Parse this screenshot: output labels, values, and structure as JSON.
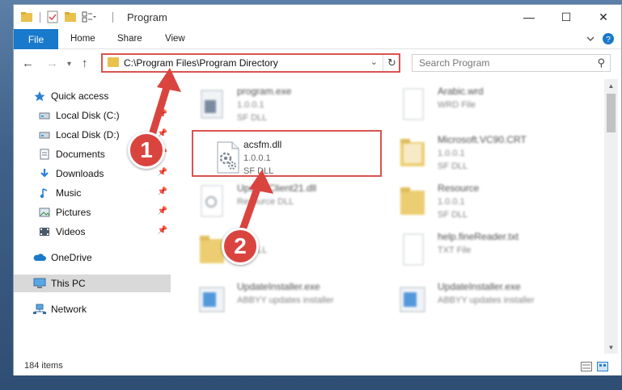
{
  "window": {
    "title": "Program",
    "controls": {
      "minimize": "—",
      "maximize": "☐",
      "close": "✕"
    }
  },
  "ribbon": {
    "tabs": [
      "File",
      "Home",
      "Share",
      "View"
    ]
  },
  "navigation": {
    "address": "C:\\Program Files\\Program Directory",
    "search_placeholder": "Search Program"
  },
  "sidebar": {
    "items": [
      {
        "label": "Quick access",
        "icon": "star-icon"
      },
      {
        "label": "Local Disk (C:)",
        "icon": "drive-icon",
        "pinned": true
      },
      {
        "label": "Local Disk (D:)",
        "icon": "drive-icon",
        "pinned": true
      },
      {
        "label": "Documents",
        "icon": "documents-icon",
        "pinned": true
      },
      {
        "label": "Downloads",
        "icon": "download-icon",
        "pinned": true
      },
      {
        "label": "Music",
        "icon": "music-icon",
        "pinned": true
      },
      {
        "label": "Pictures",
        "icon": "pictures-icon",
        "pinned": true
      },
      {
        "label": "Videos",
        "icon": "videos-icon",
        "pinned": true
      },
      {
        "label": "OneDrive",
        "icon": "cloud-icon"
      },
      {
        "label": "This PC",
        "icon": "computer-icon",
        "selected": true
      },
      {
        "label": "Network",
        "icon": "network-icon"
      }
    ]
  },
  "files": [
    {
      "name": "program.exe",
      "version": "1.0.0.1",
      "type": "SF DLL",
      "icon": "exe-icon",
      "blurred": true
    },
    {
      "name": "Arabic.wrd",
      "version": "",
      "type": "WRD File",
      "icon": "blank-file-icon",
      "blurred": true
    },
    {
      "name": "acsfm.dll",
      "version": "1.0.0.1",
      "type": "SF DLL",
      "icon": "dll-gear-icon",
      "blurred": false
    },
    {
      "name": "Microsoft.VC90.CRT",
      "version": "1.0.0.1",
      "type": "SF DLL",
      "icon": "folder-icon",
      "blurred": true
    },
    {
      "name": "UpdateClient21.dll",
      "version": "",
      "type": "Resource DLL",
      "icon": "dll-gear-icon",
      "blurred": true
    },
    {
      "name": "Resource",
      "version": "1.0.0.1",
      "type": "SF DLL",
      "icon": "folder-icon",
      "blurred": true
    },
    {
      "name": "",
      "version": "",
      "type": "SF DLL",
      "icon": "folder-icon",
      "blurred": true
    },
    {
      "name": "help.fineReader.txt",
      "version": "",
      "type": "TXT File",
      "icon": "blank-file-icon",
      "blurred": true
    },
    {
      "name": "UpdateInstaller.exe",
      "version": "",
      "type": "ABBYY updates installer",
      "icon": "installer-icon",
      "blurred": true
    },
    {
      "name": "UpdateInstaller.exe",
      "version": "",
      "type": "ABBYY updates installer",
      "icon": "installer-icon",
      "blurred": true
    }
  ],
  "status": {
    "item_count": "184 items"
  },
  "annotations": {
    "step1": "1",
    "step2": "2"
  },
  "colors": {
    "accent": "#1979ca",
    "highlight": "#d9534f",
    "badge": "#d9443f"
  }
}
